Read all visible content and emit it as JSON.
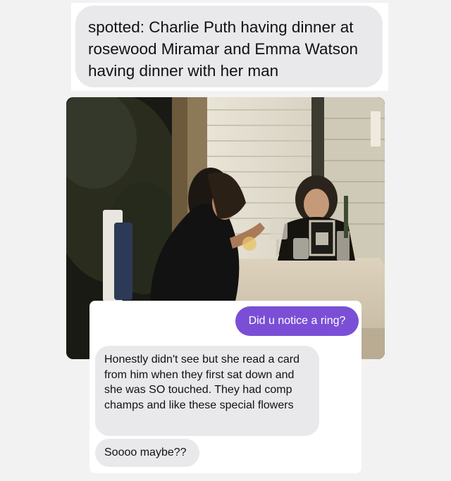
{
  "post": {
    "caption": "spotted: Charlie Puth having dinner at rosewood Miramar and Emma Watson having dinner with her man"
  },
  "photo": {
    "icon": "restaurant-dinner-photo"
  },
  "chat": {
    "messages": [
      {
        "direction": "sent",
        "text": "Did u notice a ring?"
      },
      {
        "direction": "received",
        "text": "Honestly didn't see but she read a card from him when they first sat down and she was SO touched. They had comp champs and like these special flowers"
      },
      {
        "direction": "received",
        "text": "Soooo maybe??"
      }
    ],
    "colors": {
      "sent_bubble": "#7a4fd6",
      "received_bubble": "#e9e9eb"
    }
  }
}
